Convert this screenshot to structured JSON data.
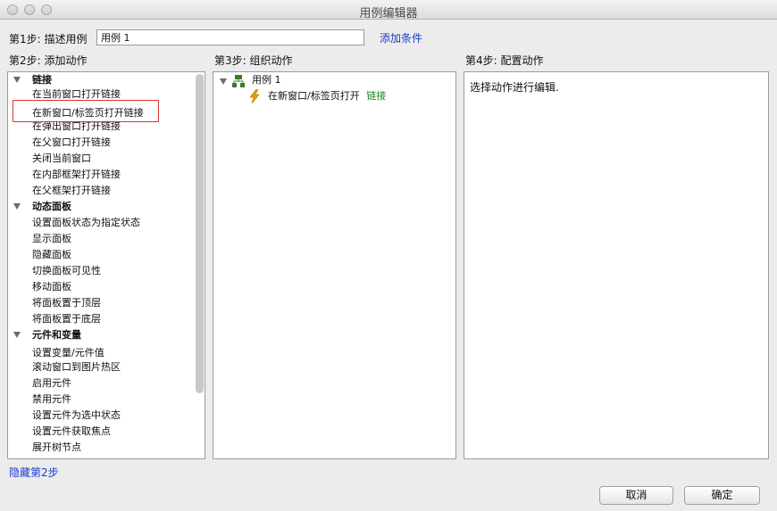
{
  "window": {
    "title": "用例编辑器"
  },
  "step1": {
    "label": "第1步: 描述用例",
    "input_value": "用例 1",
    "add_condition": "添加条件"
  },
  "step2": {
    "label": "第2步: 添加动作",
    "categories": [
      {
        "label": "链接",
        "items": [
          "在当前窗口打开链接",
          "在新窗口/标签页打开链接",
          "在弹出窗口打开链接",
          "在父窗口打开链接",
          "关闭当前窗口",
          "在内部框架打开链接",
          "在父框架打开链接"
        ]
      },
      {
        "label": "动态面板",
        "items": [
          "设置面板状态为指定状态",
          "显示面板",
          "隐藏面板",
          "切换面板可见性",
          "移动面板",
          "将面板置于顶层",
          "将面板置于底层"
        ]
      },
      {
        "label": "元件和变量",
        "items": [
          "设置变量/元件值",
          "滚动窗口到图片热区",
          "启用元件",
          "禁用元件",
          "设置元件为选中状态",
          "设置元件获取焦点",
          "展开树节点"
        ]
      }
    ],
    "hide_link": "隐藏第2步"
  },
  "step3": {
    "label": "第3步: 组织动作",
    "case_label": "用例 1",
    "action_label": "在新窗口/标签页打开",
    "action_target": "链接"
  },
  "step4": {
    "label": "第4步: 配置动作",
    "placeholder": "选择动作进行编辑."
  },
  "buttons": {
    "cancel": "取消",
    "ok": "确定"
  },
  "colors": {
    "link": "#1a3dcc",
    "highlight": "#e03030",
    "target": "#1a8a1a"
  }
}
